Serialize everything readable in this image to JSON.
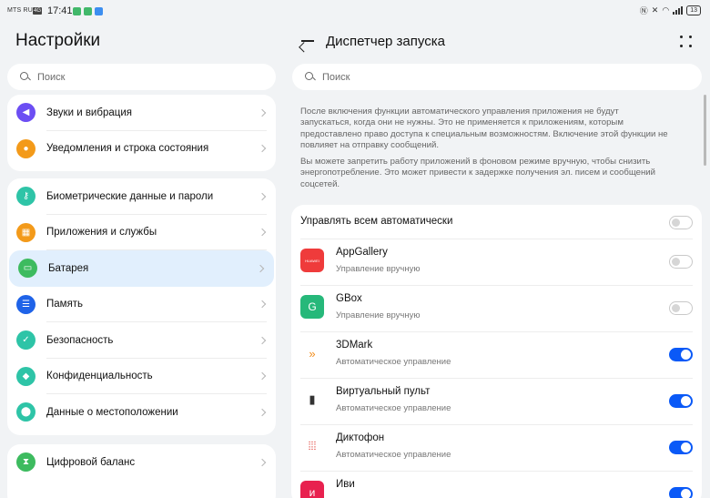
{
  "status_bar": {
    "carrier": "MTS RUS",
    "network_badge": "4G",
    "time": "17:41",
    "battery": "13",
    "colors": {
      "notif1": "#41b86a",
      "notif2": "#41b86a",
      "notif3": "#3c8ef0"
    }
  },
  "left_pane": {
    "title": "Настройки",
    "search_placeholder": "Поиск",
    "groups": [
      {
        "items": [
          {
            "label": "Звуки и вибрация",
            "icon": "speaker-icon",
            "color": "#6c4ef3",
            "glyph": "◀"
          },
          {
            "label": "Уведомления и строка состояния",
            "icon": "bell-icon",
            "color": "#f39a1a",
            "glyph": "●"
          }
        ]
      },
      {
        "items": [
          {
            "label": "Биометрические данные и пароли",
            "icon": "key-icon",
            "color": "#2ec4a7",
            "glyph": "⚷"
          },
          {
            "label": "Приложения и службы",
            "icon": "apps-icon",
            "color": "#f39a1a",
            "glyph": "▦"
          },
          {
            "label": "Батарея",
            "icon": "battery-icon",
            "color": "#3dbb5f",
            "glyph": "▭",
            "active": true
          },
          {
            "label": "Память",
            "icon": "storage-icon",
            "color": "#1f63e8",
            "glyph": "☰"
          },
          {
            "label": "Безопасность",
            "icon": "shield-check-icon",
            "color": "#2ec4a7",
            "glyph": "✓"
          },
          {
            "label": "Конфиденциальность",
            "icon": "privacy-shield-icon",
            "color": "#2ec4a7",
            "glyph": "◆"
          },
          {
            "label": "Данные о местоположении",
            "icon": "location-pin-icon",
            "color": "#2ec4a7",
            "glyph": "⬤"
          }
        ]
      },
      {
        "items": [
          {
            "label": "Цифровой баланс",
            "icon": "hourglass-icon",
            "color": "#3dbb5f",
            "glyph": "⧗"
          }
        ]
      }
    ]
  },
  "right_pane": {
    "title": "Диспетчер запуска",
    "search_placeholder": "Поиск",
    "description_1": "После включения функции автоматического управления приложения не будут запускаться, когда они не нужны. Это не применяется к приложениям, которым предоставлено право доступа к специальным возможностям. Включение этой функции не повлияет на отправку сообщений.",
    "description_2": "Вы можете запретить работу приложений в фоновом режиме вручную, чтобы снизить энергопотребление. Это может привести к задержке получения эл. писем и сообщений соцсетей.",
    "master_toggle_label": "Управлять всем автоматически",
    "master_toggle_on": false,
    "apps": [
      {
        "name": "AppGallery",
        "mode": "Управление вручную",
        "on": false,
        "icon": "appgallery-icon",
        "color": "#ef3b3b",
        "glyph": "HUAWEI"
      },
      {
        "name": "GBox",
        "mode": "Управление вручную",
        "on": false,
        "icon": "gbox-icon",
        "color": "#26b87a",
        "glyph": "G"
      },
      {
        "name": "3DMark",
        "mode": "Автоматическое управление",
        "on": true,
        "icon": "3dmark-icon",
        "color": "#f28c1a",
        "glyph": "»"
      },
      {
        "name": "Виртуальный пульт",
        "mode": "Автоматическое управление",
        "on": true,
        "icon": "remote-control-icon",
        "color": "#333333",
        "glyph": "▮"
      },
      {
        "name": "Диктофон",
        "mode": "Автоматическое управление",
        "on": true,
        "icon": "sound-wave-icon",
        "color": "#e0413a",
        "glyph": "⦙⦙⦙"
      },
      {
        "name": "Иви",
        "mode": "",
        "on": true,
        "icon": "ivi-icon",
        "color": "#e8214f",
        "glyph": "и"
      }
    ]
  }
}
